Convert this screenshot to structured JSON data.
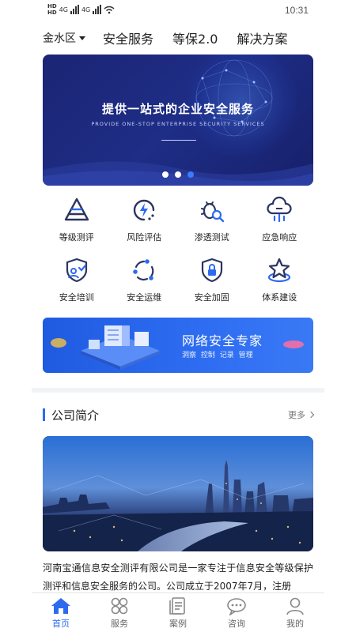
{
  "status_bar": {
    "hd_label": "HD",
    "network_1": "4G",
    "network_2": "4G",
    "time": "10:31"
  },
  "top_nav": {
    "region": "金水区",
    "items": [
      "安全服务",
      "等保2.0",
      "解决方案"
    ]
  },
  "banner": {
    "title": "提供一站式的企业安全服务",
    "subtitle": "PROVIDE ONE-STOP ENTERPRISE SECURITY SERVICES",
    "slide_count": 3,
    "active_slide": 3
  },
  "services": [
    {
      "label": "等级测评",
      "icon": "pyramid-icon"
    },
    {
      "label": "风险评估",
      "icon": "lightning-gauge-icon"
    },
    {
      "label": "渗透测试",
      "icon": "bug-search-icon"
    },
    {
      "label": "应急响应",
      "icon": "cloud-alert-icon"
    },
    {
      "label": "安全培训",
      "icon": "shield-user-icon"
    },
    {
      "label": "安全运维",
      "icon": "cycle-icon"
    },
    {
      "label": "安全加固",
      "icon": "shield-lock-icon"
    },
    {
      "label": "体系建设",
      "icon": "star-icon"
    }
  ],
  "promo": {
    "title": "网络安全专家",
    "tagline": "洞察 控制 记录 管理"
  },
  "company_section": {
    "title": "公司简介",
    "more": "更多",
    "intro": "河南宝通信息安全测评有限公司是一家专注于信息安全等级保护测评和信息安全服务的公司。公司成立于2007年7月，注册"
  },
  "tabs": [
    {
      "label": "首页",
      "icon": "home-icon",
      "active": true
    },
    {
      "label": "服务",
      "icon": "services-icon",
      "active": false
    },
    {
      "label": "案例",
      "icon": "cases-icon",
      "active": false
    },
    {
      "label": "咨询",
      "icon": "chat-icon",
      "active": false
    },
    {
      "label": "我的",
      "icon": "user-icon",
      "active": false
    }
  ],
  "colors": {
    "accent": "#2d6af0",
    "banner_bg": "#1e2d86",
    "icon_dark": "#2b3560"
  }
}
